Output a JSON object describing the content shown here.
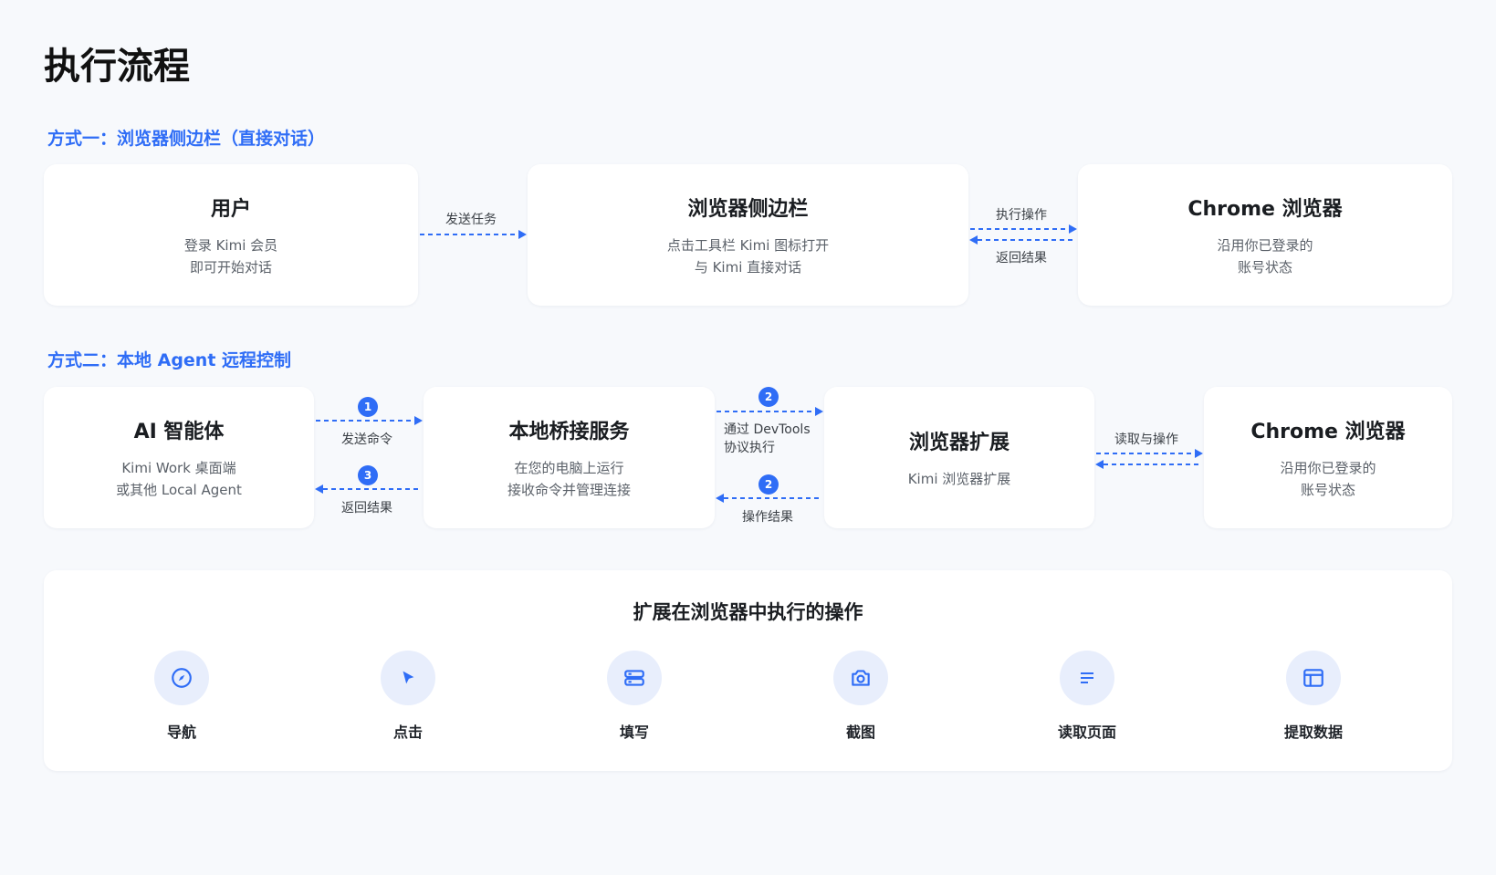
{
  "title": "执行流程",
  "method1": {
    "title": "方式一：浏览器侧边栏（直接对话）",
    "cards": [
      {
        "title": "用户",
        "lines": [
          "登录 Kimi 会员",
          "即可开始对话"
        ]
      },
      {
        "title": "浏览器侧边栏",
        "lines": [
          "点击工具栏 Kimi 图标打开",
          "与 Kimi 直接对话"
        ]
      },
      {
        "title": "Chrome 浏览器",
        "lines": [
          "沿用你已登录的",
          "账号状态"
        ]
      }
    ],
    "arrows": {
      "send_task": "发送任务",
      "execute": "执行操作",
      "return": "返回结果"
    }
  },
  "method2": {
    "title": "方式二：本地 Agent 远程控制",
    "cards": [
      {
        "title": "AI 智能体",
        "lines": [
          "Kimi Work 桌面端",
          "或其他 Local Agent"
        ]
      },
      {
        "title": "本地桥接服务",
        "lines": [
          "在您的电脑上运行",
          "接收命令并管理连接"
        ]
      },
      {
        "title": "浏览器扩展",
        "lines": [
          "Kimi 浏览器扩展"
        ]
      },
      {
        "title": "Chrome 浏览器",
        "lines": [
          "沿用你已登录的",
          "账号状态"
        ]
      }
    ],
    "arrows": {
      "send_cmd": {
        "badge": "1",
        "label": "发送命令"
      },
      "return_result": {
        "badge": "3",
        "label": "返回结果"
      },
      "devtools": {
        "badge": "2",
        "line1": "通过 DevTools",
        "line2": "协议执行"
      },
      "op_result": {
        "badge": "2",
        "label": "操作结果"
      },
      "read_op": "读取与操作"
    }
  },
  "operations": {
    "title": "扩展在浏览器中执行的操作",
    "items": [
      {
        "label": "导航",
        "icon": "compass-icon"
      },
      {
        "label": "点击",
        "icon": "cursor-icon"
      },
      {
        "label": "填写",
        "icon": "form-icon"
      },
      {
        "label": "截图",
        "icon": "camera-icon"
      },
      {
        "label": "读取页面",
        "icon": "text-lines-icon"
      },
      {
        "label": "提取数据",
        "icon": "table-icon"
      }
    ]
  },
  "colors": {
    "accent": "#2f6df6",
    "icon_bg": "#e8eefc",
    "background": "#f7f9fc"
  }
}
